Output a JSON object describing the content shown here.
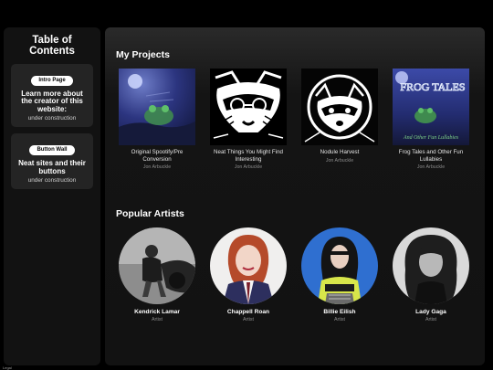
{
  "sidebar": {
    "title": "Table of Contents",
    "cards": [
      {
        "button": "Intro Page",
        "desc": "Learn more about the creator of this website:",
        "note": "under construction"
      },
      {
        "button": "Button Wall",
        "desc": "Neat sites and their buttons",
        "note": "under construction"
      }
    ]
  },
  "projects": {
    "title": "My Projects",
    "items": [
      {
        "title": "Original Spootify/Pre Conversion",
        "author": "Jon Arbuckle",
        "icon": "frog-moon-art"
      },
      {
        "title": "Neat Things You Might Find Interesting",
        "author": "Jon Arbuckle",
        "icon": "raccoon-glasses-art"
      },
      {
        "title": "Nodule Harvest",
        "author": "Jon Arbuckle",
        "icon": "raccoon-moon-art"
      },
      {
        "title": "Frog Tales and Other Fun Lullabies",
        "author": "Jon Arbuckle",
        "icon": "frog-tales-art",
        "cover_top": "FROG TALES",
        "cover_bottom": "And Other Fun Lullabies"
      }
    ]
  },
  "artists": {
    "title": "Popular Artists",
    "items": [
      {
        "name": "Kendrick Lamar",
        "type": "Artist"
      },
      {
        "name": "Chappell Roan",
        "type": "Artist"
      },
      {
        "name": "Billie Eilish",
        "type": "Artist"
      },
      {
        "name": "Lady Gaga",
        "type": "Artist"
      }
    ]
  },
  "footer": {
    "text": "Legal"
  }
}
